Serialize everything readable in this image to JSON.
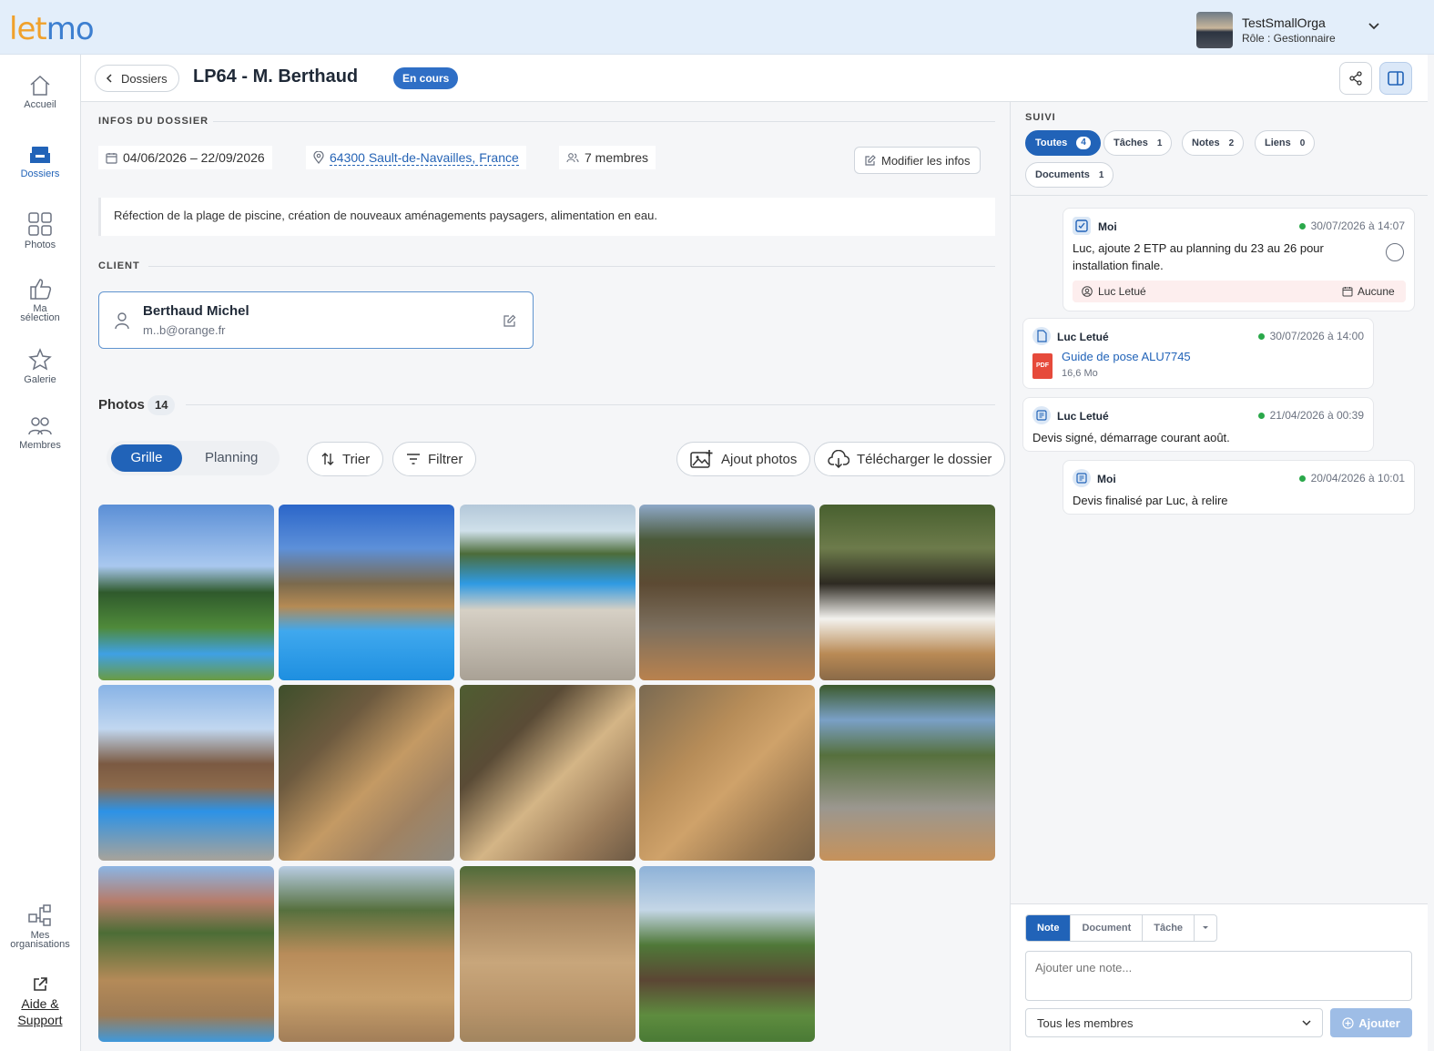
{
  "brand": {
    "logo_part1": "let",
    "logo_part2": "mo"
  },
  "org": {
    "name": "TestSmallOrga",
    "role": "Rôle : Gestionnaire"
  },
  "nav": {
    "home": "Accueil",
    "folders": "Dossiers",
    "photos": "Photos",
    "selection_1": "Ma",
    "selection_2": "sélection",
    "gallery": "Galerie",
    "members": "Membres",
    "orgs_1": "Mes",
    "orgs_2": "organisations",
    "help_1": "Aide &",
    "help_2": "Support"
  },
  "header": {
    "back_label": "Dossiers",
    "title": "LP64 - M. Berthaud",
    "status": "En cours"
  },
  "info": {
    "section_label": "INFOS DU DOSSIER",
    "dates": "04/06/2026 – 22/09/2026",
    "location": "64300 Sault-de-Navailles, France",
    "members": "7 membres",
    "edit_label": "Modifier les infos",
    "description": "Réfection de la plage de piscine, création de nouveaux aménagements paysagers, alimentation en eau."
  },
  "client": {
    "section_label": "CLIENT",
    "name": "Berthaud Michel",
    "email": "m..b@orange.fr"
  },
  "photos": {
    "title": "Photos",
    "count": "14",
    "view_grid": "Grille",
    "view_planning": "Planning",
    "sort": "Trier",
    "filter": "Filtrer",
    "add": "Ajout photos",
    "download": "Télécharger le dossier"
  },
  "suivi": {
    "section_label": "SUIVI",
    "tabs": [
      {
        "label": "Toutes",
        "count": "4"
      },
      {
        "label": "Tâches",
        "count": "1"
      },
      {
        "label": "Notes",
        "count": "2"
      },
      {
        "label": "Liens",
        "count": "0"
      },
      {
        "label": "Documents",
        "count": "1"
      }
    ],
    "entries": [
      {
        "author": "Moi",
        "date": "30/07/2026 à 14:07",
        "text": "Luc, ajoute 2 ETP au planning du 23 au 26 pour installation finale.",
        "assignee": "Luc Letué",
        "due": "Aucune"
      },
      {
        "author": "Luc Letué",
        "date": "30/07/2026 à 14:00",
        "file_name": "Guide de pose ALU7745",
        "file_size": "16,6 Mo",
        "file_type": "PDF"
      },
      {
        "author": "Luc Letué",
        "date": "21/04/2026 à 00:39",
        "text": "Devis signé, démarrage courant août."
      },
      {
        "author": "Moi",
        "date": "20/04/2026 à 10:01",
        "text": "Devis finalisé par Luc, à relire"
      }
    ]
  },
  "composer": {
    "modes": [
      "Note",
      "Document",
      "Tâche"
    ],
    "placeholder": "Ajouter une note...",
    "audience": "Tous les membres",
    "submit": "Ajouter"
  },
  "colors": {
    "primary": "#2163b8",
    "status_green": "#2aa84a",
    "topbar": "#e3eefa"
  }
}
